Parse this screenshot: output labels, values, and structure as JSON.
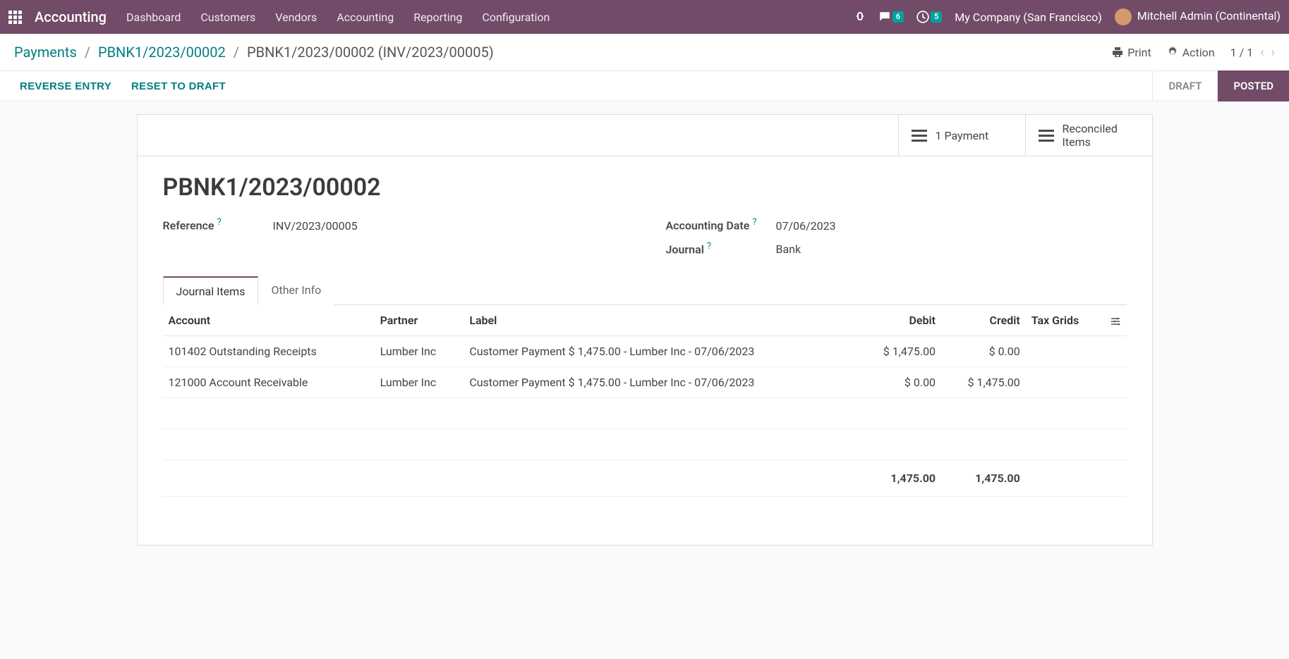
{
  "nav": {
    "brand": "Accounting",
    "menu": [
      "Dashboard",
      "Customers",
      "Vendors",
      "Accounting",
      "Reporting",
      "Configuration"
    ],
    "messages_badge": "6",
    "activities_badge": "5",
    "company": "My Company (San Francisco)",
    "user": "Mitchell Admin (Continental)"
  },
  "breadcrumb": {
    "root": "Payments",
    "parent": "PBNK1/2023/00002",
    "current": "PBNK1/2023/00002 (INV/2023/00005)"
  },
  "toolbar": {
    "print": "Print",
    "action": "Action",
    "pager_current": "1",
    "pager_total": "1"
  },
  "actions": {
    "reverse": "REVERSE ENTRY",
    "reset": "RESET TO DRAFT",
    "draft": "DRAFT",
    "posted": "POSTED"
  },
  "stat": {
    "payment": "1 Payment",
    "reconciled_line1": "Reconciled",
    "reconciled_line2": "Items"
  },
  "record": {
    "title": "PBNK1/2023/00002",
    "ref_label": "Reference",
    "ref_value": "INV/2023/00005",
    "date_label": "Accounting Date",
    "date_value": "07/06/2023",
    "journal_label": "Journal",
    "journal_value": "Bank"
  },
  "tabs": {
    "journal_items": "Journal Items",
    "other_info": "Other Info"
  },
  "columns": {
    "account": "Account",
    "partner": "Partner",
    "label": "Label",
    "debit": "Debit",
    "credit": "Credit",
    "tax_grids": "Tax Grids"
  },
  "rows": [
    {
      "account": "101402 Outstanding Receipts",
      "partner": "Lumber Inc",
      "label": "Customer Payment $ 1,475.00 - Lumber Inc - 07/06/2023",
      "debit": "$ 1,475.00",
      "credit": "$ 0.00",
      "tax": ""
    },
    {
      "account": "121000 Account Receivable",
      "partner": "Lumber Inc",
      "label": "Customer Payment $ 1,475.00 - Lumber Inc - 07/06/2023",
      "debit": "$ 0.00",
      "credit": "$ 1,475.00",
      "tax": ""
    }
  ],
  "totals": {
    "debit": "1,475.00",
    "credit": "1,475.00"
  }
}
